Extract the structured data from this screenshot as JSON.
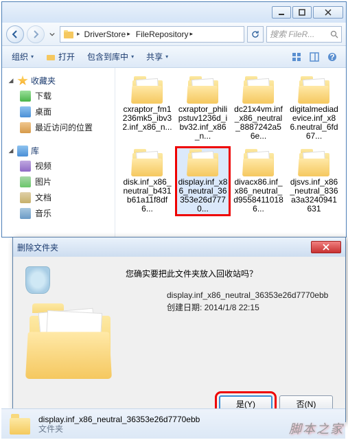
{
  "window": {
    "min_icon": "minimize-icon",
    "max_icon": "maximize-icon",
    "close_icon": "close-icon"
  },
  "nav": {
    "back_icon": "back-arrow-icon",
    "fwd_icon": "forward-arrow-icon",
    "drop_icon": "chevron-down-icon",
    "refresh_icon": "refresh-icon",
    "path": {
      "seg1": "DriverStore",
      "seg2": "FileRepository"
    },
    "search_placeholder": "搜索 FileR..."
  },
  "toolbar": {
    "organize": "组织",
    "open": "打开",
    "include": "包含到库中",
    "share": "共享"
  },
  "sidebar": {
    "favorites": {
      "head": "收藏夹",
      "items": [
        "下载",
        "桌面",
        "最近访问的位置"
      ]
    },
    "libraries": {
      "head": "库",
      "items": [
        "视频",
        "图片",
        "文档",
        "音乐"
      ]
    }
  },
  "files": [
    {
      "name": "cxraptor_fm1236mk5_ibv32.inf_x86_n..."
    },
    {
      "name": "cxraptor_philipstuv1236d_ibv32.inf_x86_n..."
    },
    {
      "name": "dc21x4vm.inf_x86_neutral_8887242a56e..."
    },
    {
      "name": "digitalmediadevice.inf_x86.neutral_6fd67..."
    },
    {
      "name": "disk.inf_x86_neutral_b431b61a11f8df6..."
    },
    {
      "name": "display.inf_x86_neutral_36353e26d7770...",
      "selected": true
    },
    {
      "name": "divacx86.inf_x86_neutral_d95584110186..."
    },
    {
      "name": "djsvs.inf_x86_neutral_836a3a3240941631"
    }
  ],
  "dialog": {
    "title": "删除文件夹",
    "question": "您确实要把此文件夹放入回收站吗？",
    "filename": "display.inf_x86_neutral_36353e26d7770ebb",
    "created_label": "创建日期: 2014/1/8 22:15",
    "yes": "是(Y)",
    "no": "否(N)"
  },
  "footer": {
    "name": "display.inf_x86_neutral_36353e26d7770ebb",
    "type": "文件夹"
  },
  "watermark": "脚本之家"
}
